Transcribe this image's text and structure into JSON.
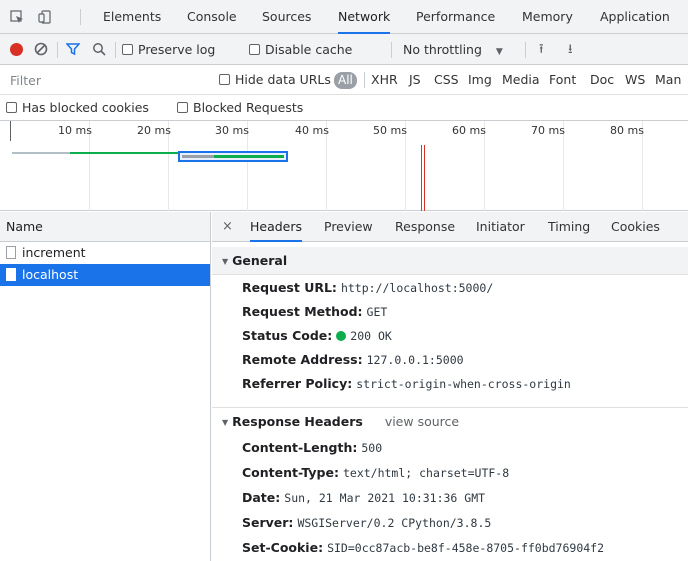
{
  "tabs": [
    "Elements",
    "Console",
    "Sources",
    "Network",
    "Performance",
    "Memory",
    "Application"
  ],
  "active_tab": "Network",
  "toolbar": {
    "preserve_log": "Preserve log",
    "disable_cache": "Disable cache",
    "throttling": "No throttling",
    "throttling_arrow": "▼",
    "upload_glyph": "⭱",
    "download_glyph": "⭳"
  },
  "filter": {
    "placeholder": "Filter",
    "hide_data_urls": "Hide data URLs",
    "types": [
      "All",
      "XHR",
      "JS",
      "CSS",
      "Img",
      "Media",
      "Font",
      "Doc",
      "WS",
      "Man"
    ]
  },
  "blocked": {
    "has_blocked_cookies": "Has blocked cookies",
    "blocked_requests": "Blocked Requests"
  },
  "overview": {
    "ticks": [
      "10 ms",
      "20 ms",
      "30 ms",
      "40 ms",
      "50 ms",
      "60 ms",
      "70 ms",
      "80 ms"
    ]
  },
  "requests": {
    "header": "Name",
    "items": [
      "increment",
      "localhost"
    ],
    "selected": "localhost"
  },
  "detail": {
    "close_glyph": "×",
    "tabs": [
      "Headers",
      "Preview",
      "Response",
      "Initiator",
      "Timing",
      "Cookies"
    ],
    "active_tab": "Headers",
    "general": {
      "title": "General",
      "rows": [
        {
          "key": "Request URL:",
          "value": "http://localhost:5000/"
        },
        {
          "key": "Request Method:",
          "value": "GET"
        },
        {
          "key": "Status Code:",
          "value": "200 OK"
        },
        {
          "key": "Remote Address:",
          "value": "127.0.0.1:5000"
        },
        {
          "key": "Referrer Policy:",
          "value": "strict-origin-when-cross-origin"
        }
      ]
    },
    "response_headers": {
      "title": "Response Headers",
      "view_source": "view source",
      "rows": [
        {
          "key": "Content-Length:",
          "value": "500"
        },
        {
          "key": "Content-Type:",
          "value": "text/html; charset=UTF-8"
        },
        {
          "key": "Date:",
          "value": "Sun, 21 Mar 2021 10:31:36 GMT"
        },
        {
          "key": "Server:",
          "value": "WSGIServer/0.2 CPython/3.8.5"
        },
        {
          "key": "Set-Cookie:",
          "value": "SID=0cc87acb-be8f-458e-8705-ff0bd76904f2"
        }
      ]
    }
  },
  "colors": {
    "accent": "#1a73e8",
    "record": "#d93025",
    "status_ok": "#0cad4c"
  }
}
